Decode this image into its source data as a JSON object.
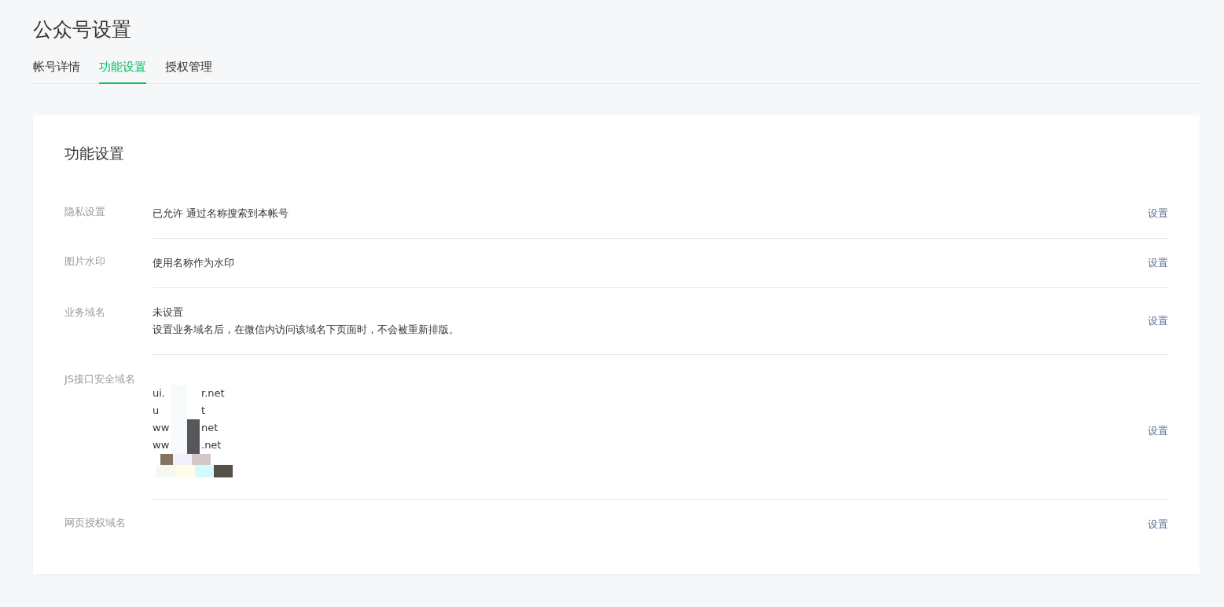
{
  "page_title": "公众号设置",
  "tabs": [
    {
      "label": "帐号详情",
      "selected": false
    },
    {
      "label": "功能设置",
      "selected": true
    },
    {
      "label": "授权管理",
      "selected": false
    }
  ],
  "card": {
    "title": "功能设置",
    "rows": [
      {
        "kind": "text",
        "label": "隐私设置",
        "lines": [
          "已允许 通过名称搜索到本帐号"
        ],
        "action": "设置"
      },
      {
        "kind": "text",
        "label": "图片水印",
        "lines": [
          "使用名称作为水印"
        ],
        "action": "设置"
      },
      {
        "kind": "text",
        "label": "业务域名",
        "lines": [
          "未设置",
          "设置业务域名后，在微信内访问该域名下页面时，不会被重新排版。"
        ],
        "action": "设置"
      },
      {
        "kind": "domains",
        "label": "JS接口安全域名",
        "domains": [
          {
            "start": "ui.",
            "end": "r.net"
          },
          {
            "start": "u",
            "end": "t"
          },
          {
            "start": "ww",
            "end": "net"
          },
          {
            "start": "ww",
            "end": ".net"
          }
        ],
        "action": "设置"
      },
      {
        "kind": "text",
        "label": "网页授权域名",
        "lines": [],
        "action": "设置"
      }
    ]
  }
}
